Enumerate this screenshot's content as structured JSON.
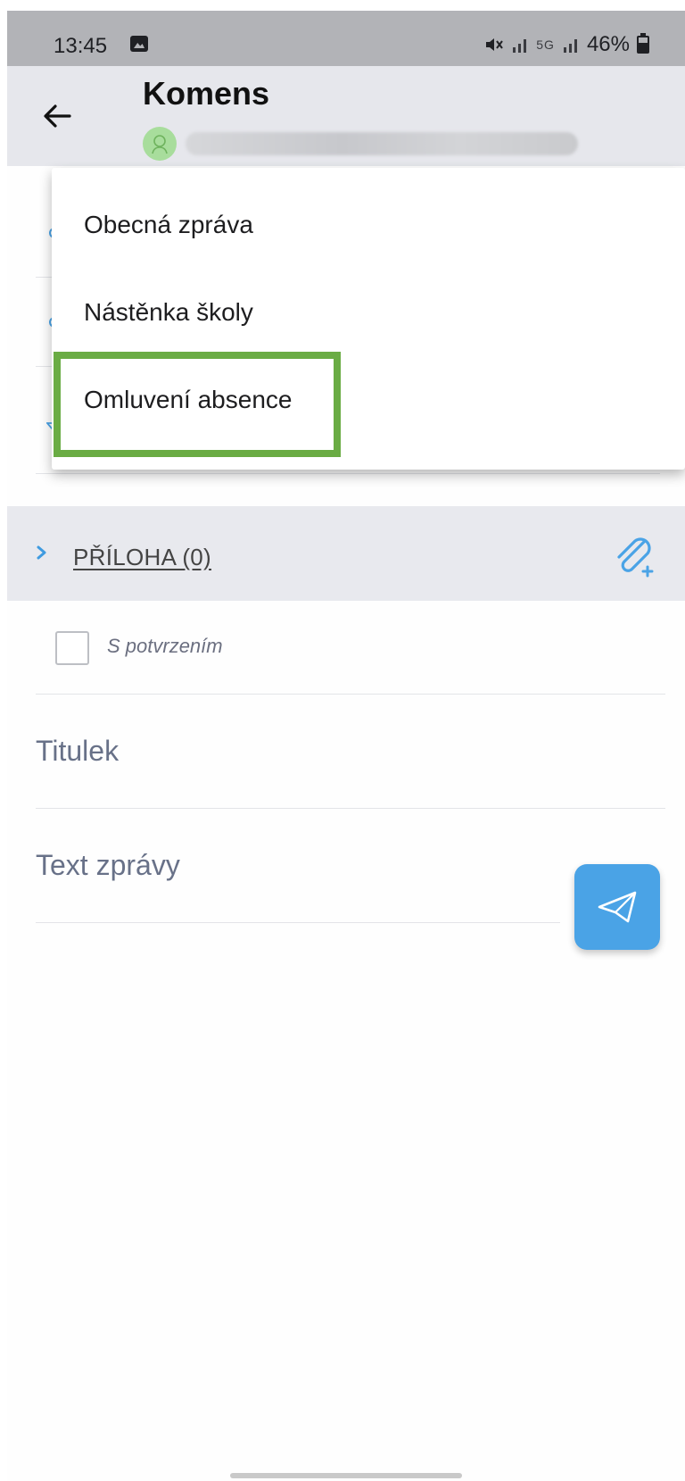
{
  "status_bar": {
    "time": "13:45",
    "network": "5G",
    "battery": "46%"
  },
  "app_bar": {
    "title": "Komens"
  },
  "dropdown": {
    "items": [
      {
        "label": "Obecná zpráva"
      },
      {
        "label": "Nástěnka školy"
      },
      {
        "label": "Omluvení absence",
        "highlighted": true
      }
    ],
    "highlight_color": "#6aac44"
  },
  "attachment": {
    "label": "PŘÍLOHA (0)"
  },
  "confirm": {
    "label": "S potvrzením",
    "checked": false
  },
  "fields": {
    "title_placeholder": "Titulek",
    "text_placeholder": "Text zprávy"
  },
  "colors": {
    "accent": "#4aa3e6",
    "status_bar_bg": "#b2b3b7",
    "app_bar_bg": "#e6e7ec",
    "avatar_bg": "#a8dd9c"
  },
  "icons": {
    "back": "arrow-left-icon",
    "attach": "paperclip-plus-icon",
    "send": "paper-plane-icon",
    "expand": "chevron-right-icon"
  }
}
